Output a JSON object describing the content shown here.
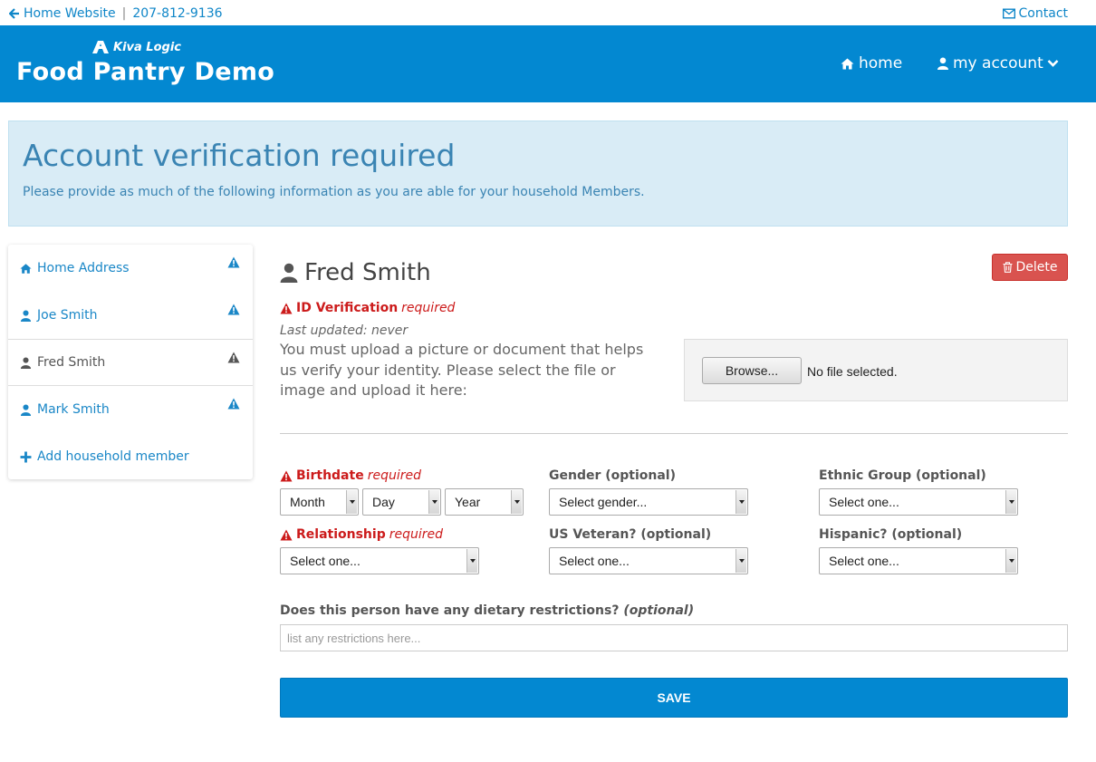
{
  "topbar": {
    "home_link": "Home Website",
    "phone": "207-812-9136",
    "contact": "Contact"
  },
  "navbar": {
    "brand_top": "Kiva Logic",
    "brand_title": "Food Pantry Demo",
    "home": "home",
    "my_account": "my account"
  },
  "alert": {
    "title": "Account verification required",
    "message": "Please provide as much of the following information as you are able for your household Members."
  },
  "sidebar": {
    "items": [
      {
        "label": "Home Address",
        "icon": "home-icon",
        "warning": true
      },
      {
        "label": "Joe Smith",
        "icon": "user-icon",
        "warning": true
      },
      {
        "label": "Fred Smith",
        "icon": "user-icon",
        "warning": true,
        "active": true
      },
      {
        "label": "Mark Smith",
        "icon": "user-icon",
        "warning": true
      },
      {
        "label": "Add household member",
        "icon": "plus-icon"
      }
    ]
  },
  "member": {
    "name": "Fred Smith",
    "delete_label": "Delete"
  },
  "id_verification": {
    "label": "ID Verification",
    "required": "required",
    "last_updated": "Last updated: never",
    "instructions": "You must upload a picture or document that helps us verify your identity. Please select the file or image and upload it here:",
    "browse_label": "Browse...",
    "no_file": "No file selected."
  },
  "form": {
    "birthdate_label": "Birthdate",
    "birthdate_required": "required",
    "month": "Month",
    "day": "Day",
    "year": "Year",
    "gender_label": "Gender (optional)",
    "gender_value": "Select gender...",
    "ethnic_label": "Ethnic Group (optional)",
    "ethnic_value": "Select one...",
    "relationship_label": "Relationship",
    "relationship_required": "required",
    "relationship_value": "Select one...",
    "veteran_label": "US Veteran? (optional)",
    "veteran_value": "Select one...",
    "hispanic_label": "Hispanic? (optional)",
    "hispanic_value": "Select one...",
    "diet_label": "Does this person have any dietary restrictions?",
    "diet_optional": "(optional)",
    "diet_placeholder": "list any restrictions here...",
    "save_label": "SAVE"
  },
  "colors": {
    "brand_blue": "#0388d1",
    "alert_bg": "#d9ecf6",
    "danger": "#d9534f",
    "required_red": "#cc1b1b"
  }
}
